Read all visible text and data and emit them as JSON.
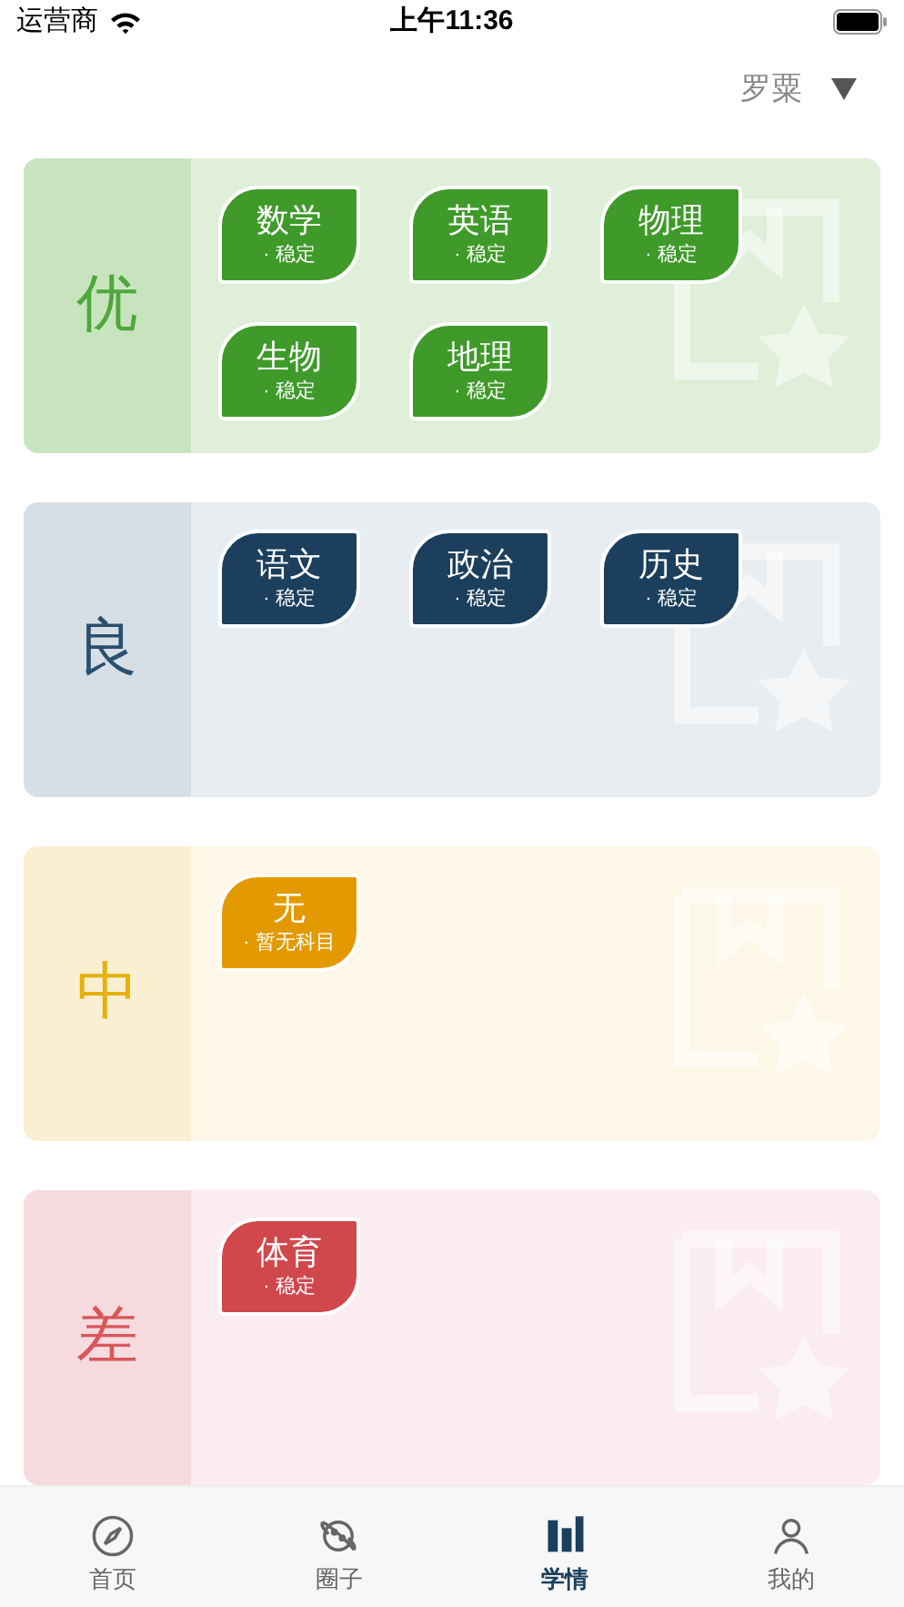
{
  "status_bar": {
    "carrier": "运营商",
    "time": "上午11:36"
  },
  "student": {
    "name": "罗粟"
  },
  "grades": [
    {
      "label": "优",
      "color": "#3f9a2a",
      "subjects": [
        {
          "name": "数学",
          "status": "· 稳定"
        },
        {
          "name": "英语",
          "status": "· 稳定"
        },
        {
          "name": "物理",
          "status": "· 稳定"
        },
        {
          "name": "生物",
          "status": "· 稳定"
        },
        {
          "name": "地理",
          "status": "· 稳定"
        }
      ]
    },
    {
      "label": "良",
      "color": "#1b3f5c",
      "subjects": [
        {
          "name": "语文",
          "status": "· 稳定"
        },
        {
          "name": "政治",
          "status": "· 稳定"
        },
        {
          "name": "历史",
          "status": "· 稳定"
        }
      ]
    },
    {
      "label": "中",
      "color": "#e39a00",
      "subjects": [
        {
          "name": "无",
          "status": "· 暂无科目"
        }
      ]
    },
    {
      "label": "差",
      "color": "#d0474c",
      "subjects": [
        {
          "name": "体育",
          "status": "· 稳定"
        }
      ]
    }
  ],
  "tabs": [
    {
      "label": "首页",
      "kind": "compass",
      "selected": false
    },
    {
      "label": "圈子",
      "kind": "planet",
      "selected": false
    },
    {
      "label": "学情",
      "kind": "chart",
      "selected": true
    },
    {
      "label": "我的",
      "kind": "person",
      "selected": false
    }
  ]
}
